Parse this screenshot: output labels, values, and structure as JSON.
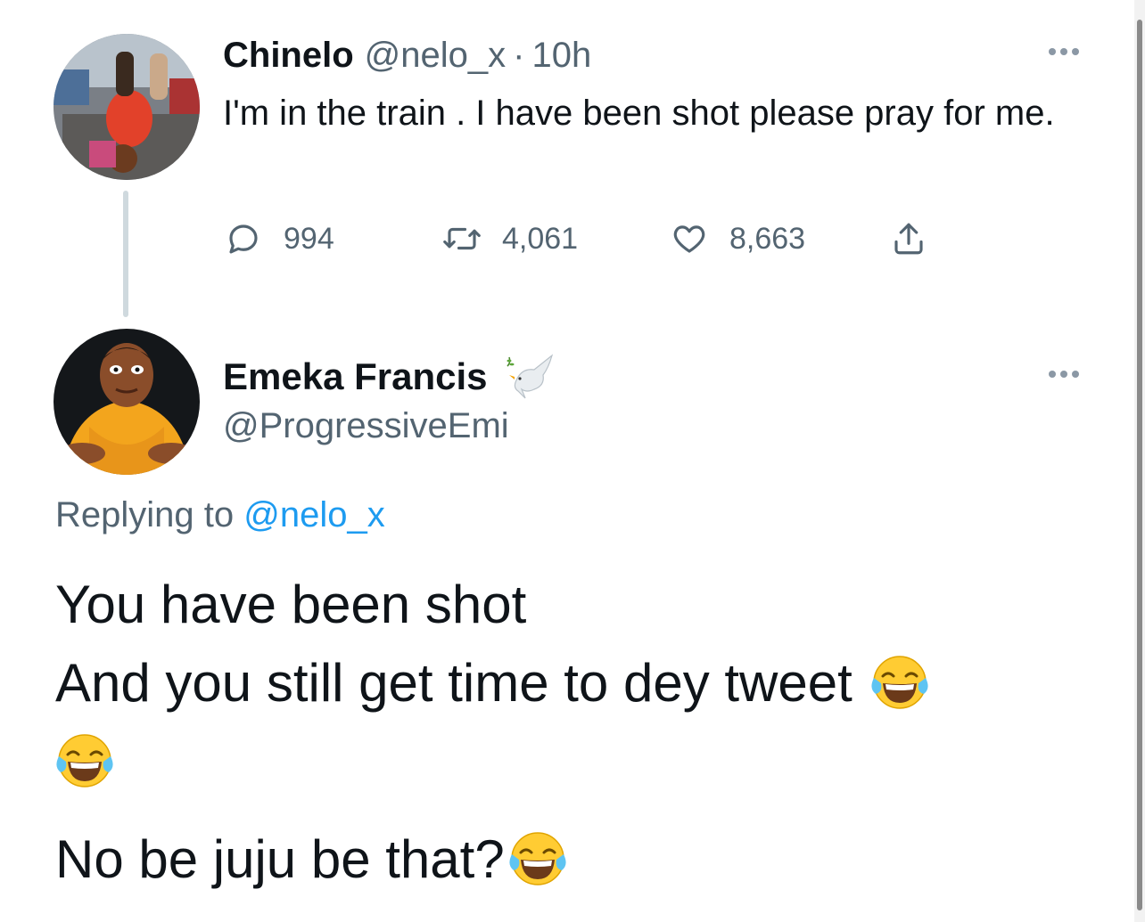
{
  "tweet_original": {
    "author_name": "Chinelo",
    "author_handle": "@nelo_x",
    "separator": "·",
    "time": "10h",
    "text": "I'm in the train .  I have been shot please pray for me.",
    "counts": {
      "replies": "994",
      "retweets": "4,061",
      "likes": "8,663"
    }
  },
  "tweet_reply": {
    "author_name": "Emeka Francis",
    "name_emoji": "dove-of-peace",
    "author_handle": "@ProgressiveEmi",
    "replying_prefix": "Replying to",
    "replying_mention": "@nelo_x",
    "line1": "You have been shot",
    "line2": "And you still get time to dey tweet",
    "line4": "No be juju be that?",
    "emoji": "face-with-tears-of-joy"
  },
  "colors": {
    "text": "#0f1419",
    "secondary": "#536471",
    "link": "#1d9bf0",
    "thread_line": "#cfd9de"
  },
  "icons": [
    "reply-icon",
    "retweet-icon",
    "like-icon",
    "share-icon",
    "more-icon"
  ]
}
